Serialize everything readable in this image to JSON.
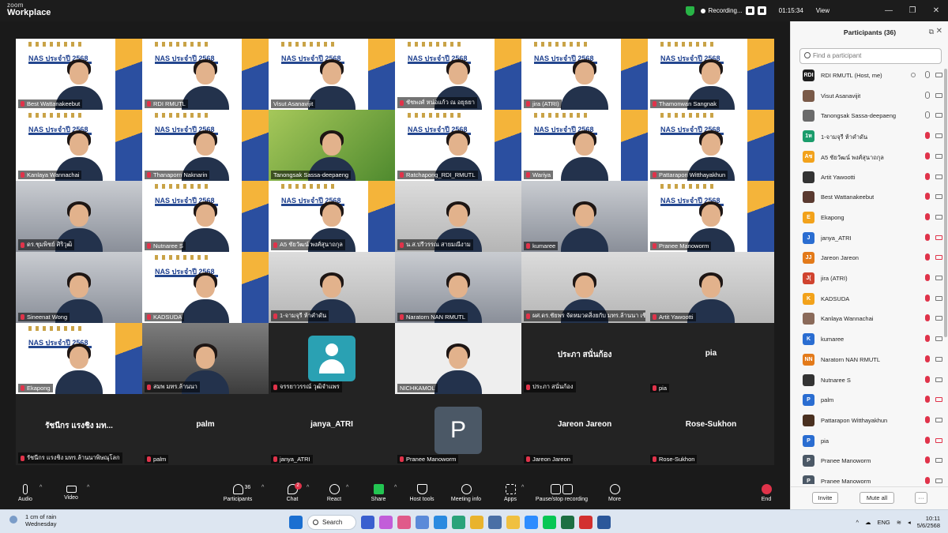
{
  "app": {
    "logo_top": "zoom",
    "logo_bottom": "Workplace"
  },
  "titlebar": {
    "recording": "Recording...",
    "timer": "01:15:34",
    "view": "View",
    "win_min": "—",
    "win_max": "❐",
    "win_close": "✕"
  },
  "banner_title": "NAS ประจำปี 2568",
  "tiles": [
    {
      "name": "Best Wattanakeebut",
      "kind": "banner",
      "muted": true
    },
    {
      "name": "RDI RMUTL",
      "kind": "banner",
      "muted": true,
      "active": true
    },
    {
      "name": "Visut Asanavijit",
      "kind": "banner",
      "muted": false
    },
    {
      "name": "ชัชพงศ์ หน่อแก้ว ณ อยุธยา",
      "kind": "banner",
      "muted": true
    },
    {
      "name": "jira (ATRI)",
      "kind": "banner",
      "muted": true
    },
    {
      "name": "Thamonwan Sangnak",
      "kind": "banner",
      "muted": true
    },
    {
      "name": "Kanlaya Wannachai",
      "kind": "banner",
      "muted": true
    },
    {
      "name": "Thanaporn Naknarin",
      "kind": "banner",
      "muted": true
    },
    {
      "name": "Tanongsak Sassa-deepaeng",
      "kind": "green",
      "muted": false
    },
    {
      "name": "Ratchapong_RDI_RMUTL",
      "kind": "banner",
      "muted": true
    },
    {
      "name": "Wariya",
      "kind": "banner",
      "muted": true
    },
    {
      "name": "Pattarapon Witthayakhun",
      "kind": "banner",
      "muted": true
    },
    {
      "name": "ดร.ชุมพิชย์ ศิริวุฒิ",
      "kind": "room",
      "muted": true
    },
    {
      "name": "Nutnaree S",
      "kind": "banner",
      "muted": true
    },
    {
      "name": "A5 ชัยวัฒน์ พงศ์สุนาถกุล",
      "kind": "banner",
      "muted": true
    },
    {
      "name": "น.ส.ปรีวรรณ สายมณีงาม",
      "kind": "wall",
      "muted": true
    },
    {
      "name": "kumaree",
      "kind": "room",
      "muted": true
    },
    {
      "name": "Pranee Manoworm",
      "kind": "banner",
      "muted": true
    },
    {
      "name": "Sineenat Wong",
      "kind": "room",
      "muted": true
    },
    {
      "name": "KADSUDA",
      "kind": "banner",
      "muted": true
    },
    {
      "name": "1-จามจุรี ห้าคำดัน",
      "kind": "wall",
      "muted": true
    },
    {
      "name": "Naratorn NAN RMUTL",
      "kind": "room",
      "muted": true
    },
    {
      "name": "ผศ.ดร.ชัยพร จัดหมวดสิ่งยกับ มทร.ล้านนา เชียงราย",
      "kind": "wall",
      "muted": true
    },
    {
      "name": "Artit Yawootti",
      "kind": "wall",
      "muted": true
    },
    {
      "name": "Ekapong",
      "kind": "banner",
      "muted": true
    },
    {
      "name": "สมพ มทร.ล้านนา",
      "kind": "car",
      "muted": true
    },
    {
      "name": "จรรยาวรรณ์ วุฒิจำแพร",
      "kind": "avatar",
      "muted": true
    },
    {
      "name": "NICHKAMOL",
      "kind": "portrait",
      "muted": false
    },
    {
      "name": "ประภา สนั่นก้อง",
      "kind": "text",
      "big": "ประภา สนั่นก้อง",
      "muted": true
    },
    {
      "name": "pia",
      "kind": "text",
      "big": "pia",
      "muted": true
    },
    {
      "name": "รัชนีกร แรงชิง มทร.ล้านนาพิษณุโลก",
      "kind": "text",
      "big": "รัชนีกร แรงชิง มท...",
      "muted": true
    },
    {
      "name": "palm",
      "kind": "text",
      "big": "palm",
      "muted": true
    },
    {
      "name": "janya_ATRI",
      "kind": "text",
      "big": "janya_ATRI",
      "muted": true
    },
    {
      "name": "Pranee Manoworm",
      "kind": "letter",
      "big": "P",
      "muted": true
    },
    {
      "name": "Jareon Jareon",
      "kind": "text",
      "big": "Jareon Jareon",
      "muted": true
    },
    {
      "name": "Rose-Sukhon",
      "kind": "text",
      "big": "Rose-Sukhon",
      "muted": true
    }
  ],
  "panel": {
    "title": "Participants (36)",
    "search_placeholder": "Find a participant",
    "invite": "Invite",
    "mute_all": "Mute all",
    "more": "···",
    "participants": [
      {
        "name": "RDI RMUTL (Host, me)",
        "av": "RDI",
        "color": "#1e1e1e",
        "mic": "on",
        "cam": "on"
      },
      {
        "name": "Visut Asanavijit",
        "av": "",
        "color": "#7a5a48",
        "mic": "on",
        "cam": "on"
      },
      {
        "name": "Tanongsak Sassa-deepaeng",
        "av": "",
        "color": "#6a6a6a",
        "mic": "on",
        "cam": "on"
      },
      {
        "name": "1-จามจุรี ห้าคำดัน",
        "av": "1ห",
        "color": "#1a9c6b",
        "mic": "off",
        "cam": "on"
      },
      {
        "name": "A5 ชัยวัฒน์ พงศ์สุนาถกุล",
        "av": "Aช",
        "color": "#f2a21b",
        "mic": "off",
        "cam": "on"
      },
      {
        "name": "Artit Yawootti",
        "av": "",
        "color": "#333",
        "mic": "off",
        "cam": "on"
      },
      {
        "name": "Best Wattanakeebut",
        "av": "",
        "color": "#5a3a30",
        "mic": "off",
        "cam": "on"
      },
      {
        "name": "Ekapong",
        "av": "E",
        "color": "#f2a21b",
        "mic": "off",
        "cam": "on"
      },
      {
        "name": "janya_ATRI",
        "av": "J",
        "color": "#2a6dd1",
        "mic": "off",
        "cam": "off"
      },
      {
        "name": "Jareon Jareon",
        "av": "JJ",
        "color": "#e37a1a",
        "mic": "off",
        "cam": "off"
      },
      {
        "name": "jira (ATRI)",
        "av": "J(",
        "color": "#d0432f",
        "mic": "off",
        "cam": "on"
      },
      {
        "name": "KADSUDA",
        "av": "K",
        "color": "#f2a21b",
        "mic": "off",
        "cam": "on"
      },
      {
        "name": "Kanlaya Wannachai",
        "av": "",
        "color": "#8a6a5a",
        "mic": "off",
        "cam": "on"
      },
      {
        "name": "kumaree",
        "av": "K",
        "color": "#2a6dd1",
        "mic": "off",
        "cam": "on"
      },
      {
        "name": "Naratorn NAN RMUTL",
        "av": "NN",
        "color": "#e37a1a",
        "mic": "off",
        "cam": "on"
      },
      {
        "name": "Nutnaree S",
        "av": "",
        "color": "#333",
        "mic": "off",
        "cam": "on"
      },
      {
        "name": "palm",
        "av": "P",
        "color": "#2a6dd1",
        "mic": "off",
        "cam": "off"
      },
      {
        "name": "Pattarapon Witthayakhun",
        "av": "",
        "color": "#4a3020",
        "mic": "off",
        "cam": "on"
      },
      {
        "name": "pia",
        "av": "P",
        "color": "#2a6dd1",
        "mic": "off",
        "cam": "off"
      },
      {
        "name": "Pranee Manoworm",
        "av": "P",
        "color": "#4b5866",
        "mic": "off",
        "cam": "on"
      },
      {
        "name": "Pranee Manoworm",
        "av": "P",
        "color": "#4b5866",
        "mic": "off",
        "cam": "on"
      }
    ]
  },
  "toolbar": {
    "audio": "Audio",
    "video": "Video",
    "participants": "Participants",
    "participants_count": "36",
    "chat": "Chat",
    "chat_badge": "2",
    "react": "React",
    "share": "Share",
    "host_tools": "Host tools",
    "meeting_info": "Meeting info",
    "apps": "Apps",
    "record": "Pause/stop recording",
    "more": "More",
    "end": "End"
  },
  "taskbar": {
    "weather_line1": "1 cm of rain",
    "weather_line2": "Wednesday",
    "search": "Search",
    "lang": "ENG",
    "time": "10:11",
    "date": "5/6/2568"
  }
}
